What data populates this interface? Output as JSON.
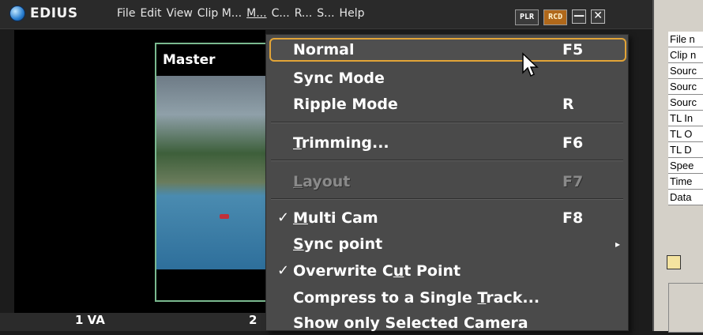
{
  "app": {
    "name": "EDIUS"
  },
  "menubar": {
    "items": [
      "File",
      "Edit",
      "View",
      "Clip M...",
      "M...",
      "C...",
      "R...",
      "S...",
      "Help"
    ],
    "active_index": 4
  },
  "title_buttons": {
    "plr": "PLR",
    "rcd": "RCD",
    "minimize": "—",
    "close": "✕"
  },
  "player": {
    "master_label": "Master",
    "track_label": "1 VA",
    "camera_label": "2"
  },
  "right_panel": {
    "info_rows": [
      "File n",
      "Clip n",
      "Sourc",
      "Sourc",
      "Sourc",
      "TL In",
      "TL O",
      "TL D",
      "Spee",
      "Time",
      "Data"
    ]
  },
  "dropdown": {
    "items": [
      {
        "label": "Normal",
        "shortcut": "F5",
        "selected": true
      },
      {
        "label": "Sync Mode",
        "shortcut": ""
      },
      {
        "label": "Ripple Mode",
        "shortcut": "R"
      },
      {
        "label": "Trimming...",
        "shortcut": "F6"
      },
      {
        "label": "Layout",
        "shortcut": "F7",
        "disabled": true
      },
      {
        "label": "Multi Cam",
        "shortcut": "F8",
        "checked": true
      },
      {
        "label": "Sync point",
        "submenu": true
      },
      {
        "label": "Overwrite Cut Point",
        "checked": true
      },
      {
        "label": "Compress to a Single Track..."
      },
      {
        "label": "Show only Selected Camera"
      }
    ],
    "check_glyph": "✓",
    "submenu_glyph": "▸"
  },
  "colors": {
    "selection_border": "#e2a437",
    "menu_bg": "#4a4a4a",
    "master_border": "#7ab98f"
  }
}
